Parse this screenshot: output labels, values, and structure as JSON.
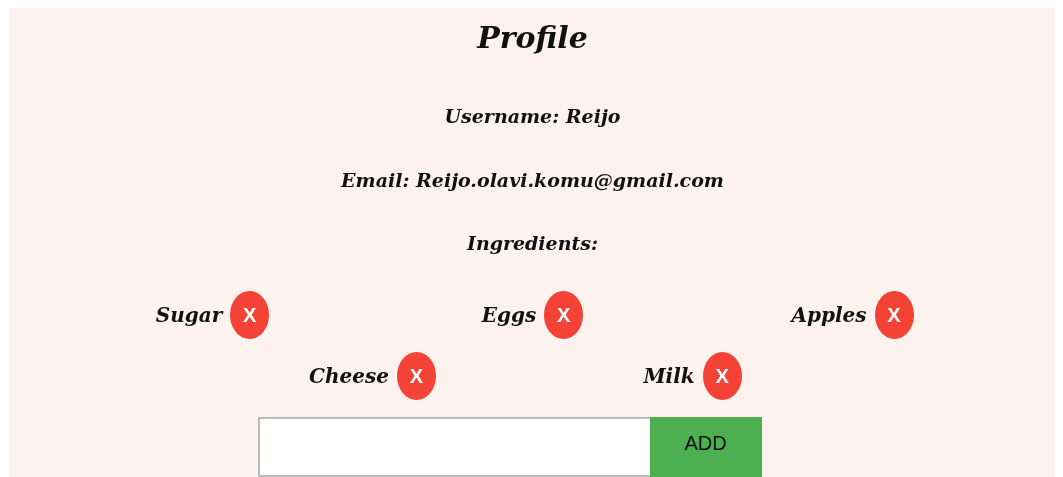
{
  "title": "Profile",
  "username": "Username: Reijo",
  "email": "Email: Reijo.olavi.komu@gmail.com",
  "ingredients_heading": "Ingredients:",
  "ingredients": [
    {
      "name": "Sugar",
      "remove": "X"
    },
    {
      "name": "Eggs",
      "remove": "X"
    },
    {
      "name": "Apples",
      "remove": "X"
    },
    {
      "name": "Cheese",
      "remove": "X"
    },
    {
      "name": "Milk",
      "remove": "X"
    }
  ],
  "add_form": {
    "button": "ADD"
  }
}
